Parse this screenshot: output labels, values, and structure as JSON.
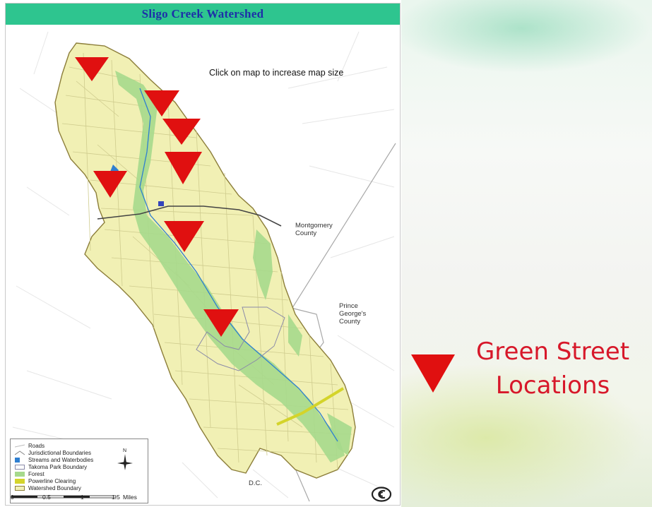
{
  "map": {
    "title": "Sligo Creek Watershed",
    "instruction": "Click on map to increase map size",
    "labels": {
      "montgomery": "Montgomery County",
      "prince_georges": "Prince George's County",
      "dc": "D.C."
    },
    "colors": {
      "title_bar": "#2ec58f",
      "title_text": "#1d2fa8",
      "watershed_fill": "#f1f0b4",
      "forest": "#a6d98c",
      "stream": "#2f7fd0",
      "powerline": "#d4d42a",
      "marker": "#e01010"
    },
    "legend": {
      "items": [
        {
          "label": "Roads",
          "swatch": "roads"
        },
        {
          "label": "Jurisdictional Boundaries",
          "swatch": "jurisdictional"
        },
        {
          "label": "Streams and Waterbodies",
          "swatch": "streams"
        },
        {
          "label": "Takoma Park Boundary",
          "swatch": "takoma"
        },
        {
          "label": "Forest",
          "swatch": "forest"
        },
        {
          "label": "Powerline Clearing",
          "swatch": "powerline"
        },
        {
          "label": "Watershed Boundary",
          "swatch": "watershed"
        }
      ],
      "north_label": "N"
    },
    "scale": {
      "ticks": [
        "0",
        "0.5",
        "1",
        "1.5"
      ],
      "unit": "Miles"
    },
    "markers_count": 7
  },
  "overlay_legend": {
    "label_line1": "Green Street",
    "label_line2": "Locations",
    "icon": "red-down-triangle-icon"
  }
}
